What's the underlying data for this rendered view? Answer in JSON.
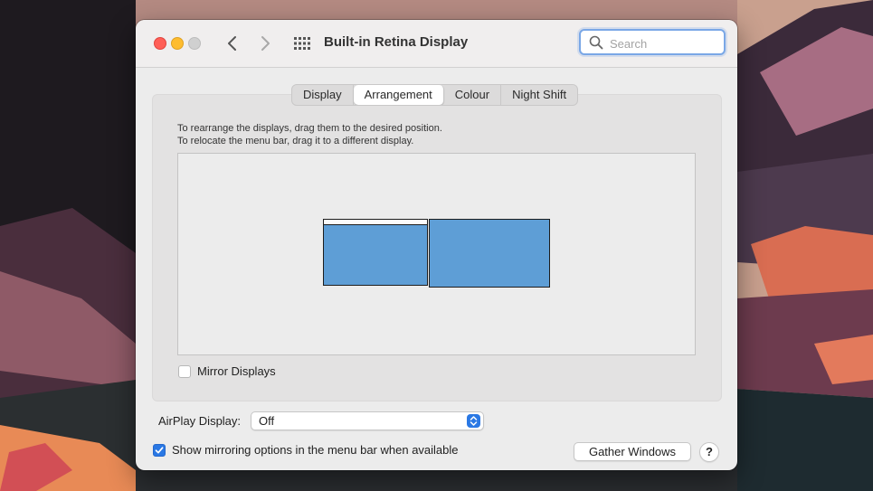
{
  "window": {
    "title": "Built-in Retina Display"
  },
  "search": {
    "placeholder": "Search"
  },
  "tabs": [
    {
      "label": "Display",
      "active": false
    },
    {
      "label": "Arrangement",
      "active": true
    },
    {
      "label": "Colour",
      "active": false
    },
    {
      "label": "Night Shift",
      "active": false
    }
  ],
  "instructions": {
    "line1": "To rearrange the displays, drag them to the desired position.",
    "line2": "To relocate the menu bar, drag it to a different display."
  },
  "mirror_displays": {
    "label": "Mirror Displays",
    "checked": false
  },
  "airplay": {
    "label": "AirPlay Display:",
    "value": "Off"
  },
  "show_mirroring": {
    "label": "Show mirroring options in the menu bar when available",
    "checked": true
  },
  "gather_windows_label": "Gather Windows",
  "help_label": "?",
  "colors": {
    "display_fill": "#5e9ed6",
    "accent": "#2a78e4",
    "search_focus": "#7aa7e6"
  },
  "icons": [
    "close-button",
    "minimize-button",
    "zoom-button",
    "chevron-left-icon",
    "chevron-right-icon",
    "grid-icon",
    "search-icon",
    "checkmark-icon",
    "updown-arrows-icon"
  ]
}
